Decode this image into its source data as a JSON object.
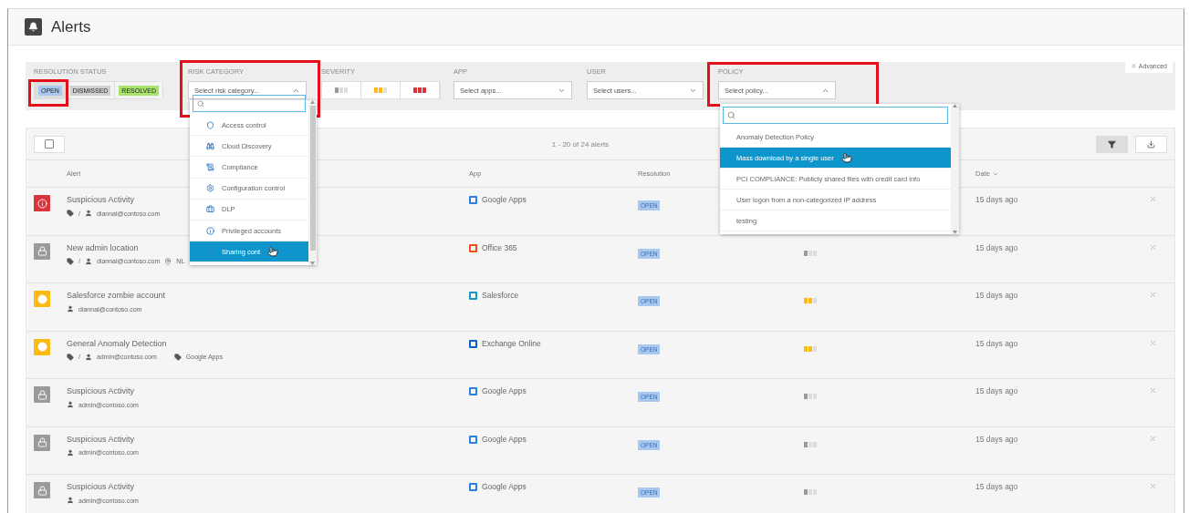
{
  "page": {
    "title": "Alerts"
  },
  "filters": {
    "advanced": "Advanced",
    "resolution_status": {
      "label": "RESOLUTION STATUS",
      "highlighted": true,
      "options": [
        {
          "label": "OPEN",
          "color": "#a8c8f0",
          "selected": true
        },
        {
          "label": "DISMISSED",
          "color": "#d0d0d0",
          "selected": false
        },
        {
          "label": "RESOLVED",
          "color": "#a6e36a",
          "selected": false
        }
      ]
    },
    "risk_category": {
      "label": "RISK CATEGORY",
      "placeholder": "Select risk category...",
      "expanded": true,
      "highlighted": true
    },
    "severity": {
      "label": "SEVERITY",
      "options": [
        {
          "stars": 1,
          "color": "#9a9a9a"
        },
        {
          "stars": 2,
          "color": "#fbb912"
        },
        {
          "stars": 3,
          "color": "#d9343c"
        }
      ]
    },
    "app": {
      "label": "APP",
      "placeholder": "Select apps...",
      "expanded": false
    },
    "user": {
      "label": "USER",
      "placeholder": "Select users...",
      "expanded": false
    },
    "policy": {
      "label": "POLICY",
      "placeholder": "Select policy...",
      "expanded": true,
      "highlighted": true
    }
  },
  "risk_dropdown": {
    "items": [
      {
        "label": "Access control",
        "selected": false
      },
      {
        "label": "Cloud Discovery",
        "selected": false
      },
      {
        "label": "Compliance",
        "selected": false
      },
      {
        "label": "Configuration control",
        "selected": false
      },
      {
        "label": "DLP",
        "selected": false
      },
      {
        "label": "Privileged accounts",
        "selected": false
      },
      {
        "label": "Sharing cont",
        "selected": true
      }
    ]
  },
  "policy_dropdown": {
    "items": [
      {
        "label": "Anomaly Detection Policy",
        "selected": false
      },
      {
        "label": "Mass download by a single user",
        "selected": true
      },
      {
        "label": "PCI COMPLIANCE: Publicly shared files with credit card info",
        "selected": false
      },
      {
        "label": "User logon from a non-categorized IP address",
        "selected": false
      },
      {
        "label": "testing",
        "selected": false
      }
    ]
  },
  "table": {
    "count": "1 - 20 of 24 alerts",
    "filter_active": true,
    "select_all": {
      "checked": false
    },
    "columns": [
      "Alert",
      "App",
      "Resolution",
      "Date"
    ],
    "rows": [
      {
        "alert": "Suspicious Activity",
        "color": "#d9343c",
        "tag_path": "/",
        "user": "diannal@contoso.com",
        "app": {
          "name": "Google Apps",
          "color": "#2f7fe0"
        },
        "resolution": "OPEN",
        "date": "15 days ago"
      },
      {
        "alert": "New admin location",
        "color": "#9a9a9a",
        "tag_path": "/",
        "user": "diannal@contoso.com",
        "location": "NL",
        "app": {
          "name": "Office 365",
          "color": "#e8501c"
        },
        "resolution": "OPEN",
        "severity_meter": {
          "stars": 1,
          "color": "#9a9a9a"
        },
        "date": "15 days ago"
      },
      {
        "alert": "Salesforce zombie account",
        "color": "#fbb912",
        "user": "diannal@contoso.com",
        "app": {
          "name": "Salesforce",
          "color": "#1798c1"
        },
        "resolution": "OPEN",
        "severity_meter": {
          "stars": 2,
          "color": "#fbb912"
        },
        "date": "15 days ago"
      },
      {
        "alert": "General Anomaly Detection",
        "color": "#fbb912",
        "tag_path": "/",
        "user": "admin@contoso.com",
        "app_tag": "Google Apps",
        "app": {
          "name": "Exchange Online",
          "color": "#0a64c8"
        },
        "resolution": "OPEN",
        "severity_meter": {
          "stars": 2,
          "color": "#fbb912"
        },
        "date": "15 days ago"
      },
      {
        "alert": "Suspicious Activity",
        "color": "#9a9a9a",
        "user": "admin@contoso.com",
        "app": {
          "name": "Google Apps",
          "color": "#2f7fe0"
        },
        "resolution": "OPEN",
        "severity_meter": {
          "stars": 1,
          "color": "#9a9a9a"
        },
        "date": "15 days ago"
      },
      {
        "alert": "Suspicious Activity",
        "color": "#9a9a9a",
        "user": "admin@contoso.com",
        "app": {
          "name": "Google Apps",
          "color": "#2f7fe0"
        },
        "resolution": "OPEN",
        "severity_meter": {
          "stars": 1,
          "color": "#9a9a9a"
        },
        "date": "15 days ago"
      },
      {
        "alert": "Suspicious Activity",
        "color": "#9a9a9a",
        "user": "admin@contoso.com",
        "app": {
          "name": "Google Apps",
          "color": "#2f7fe0"
        },
        "resolution": "OPEN",
        "severity_meter": {
          "stars": 1,
          "color": "#9a9a9a"
        },
        "date": "15 days ago"
      }
    ]
  }
}
